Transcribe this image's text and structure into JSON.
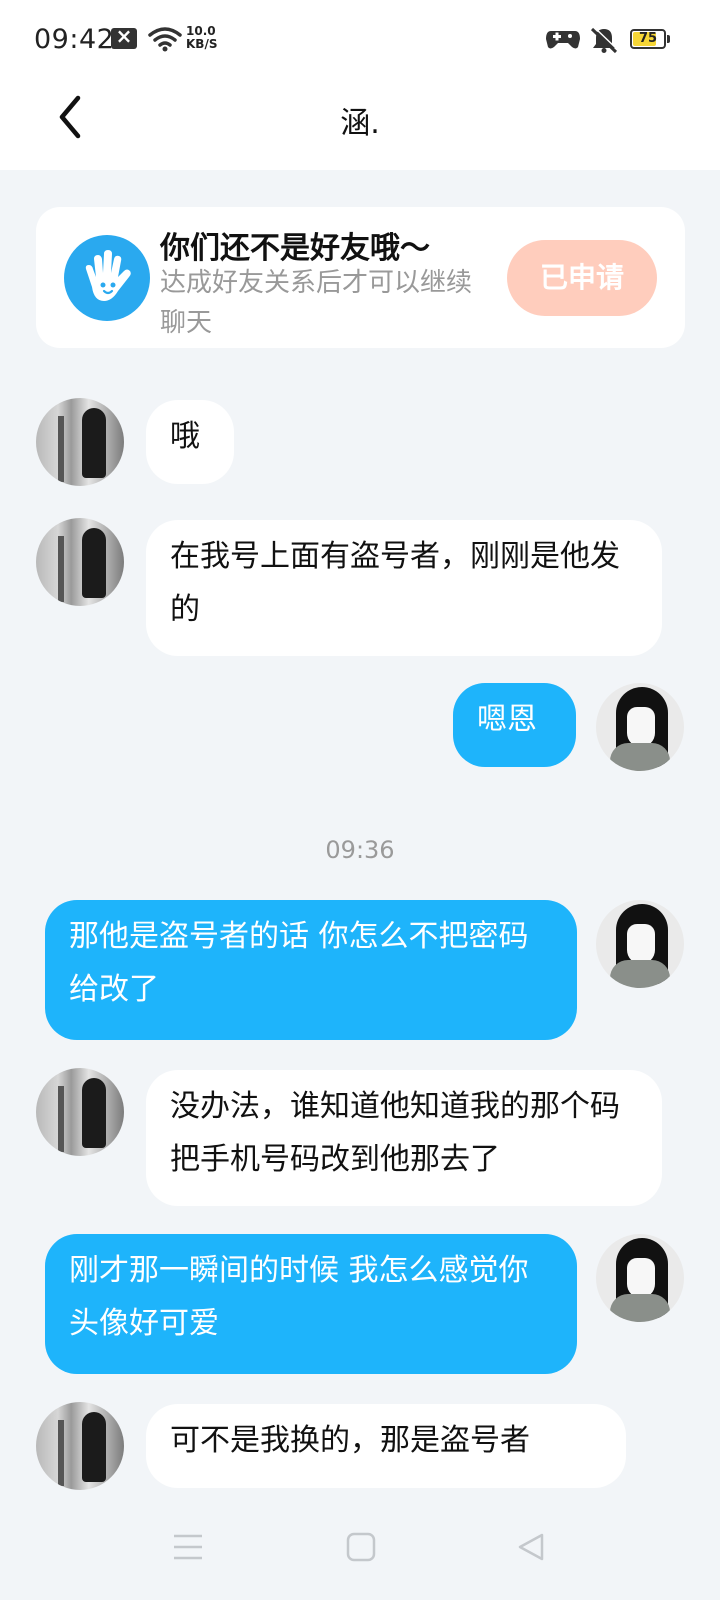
{
  "status_bar": {
    "time": "09:42",
    "net_speed_value": "10.0",
    "net_speed_unit": "KB/S",
    "battery_level": "75",
    "battery_fraction": 0.75,
    "accent_battery": "#f6d636"
  },
  "header": {
    "title": "涵."
  },
  "friend_notice": {
    "title": "你们还不是好友哦～",
    "subtitle": "达成好友关系后才可以继续聊天",
    "button_label": "已申请",
    "button_color": "#ffcdbd"
  },
  "messages": [
    {
      "side": "in",
      "text": "哦"
    },
    {
      "side": "in",
      "text": "在我号上面有盗号者，刚刚是他发的"
    },
    {
      "side": "out",
      "text": "嗯恩"
    },
    {
      "side": "out",
      "text": "那他是盗号者的话 你怎么不把密码给改了"
    },
    {
      "side": "in",
      "text": "没办法，谁知道他知道我的那个码把手机号码改到他那去了"
    },
    {
      "side": "out",
      "text": "刚才那一瞬间的时候 我怎么感觉你头像好可爱"
    },
    {
      "side": "in",
      "text": "可不是我换的，那是盗号者"
    }
  ],
  "time_divider": "09:36",
  "colors": {
    "outgoing_bubble": "#1eb4fb",
    "incoming_bubble": "#ffffff",
    "background": "#f2f5f8"
  },
  "icons": {
    "back": "chevron-left-icon",
    "notice": "hand-wave-icon",
    "nav_menu": "menu-icon",
    "nav_home": "home-square-icon",
    "nav_back": "triangle-back-icon"
  }
}
